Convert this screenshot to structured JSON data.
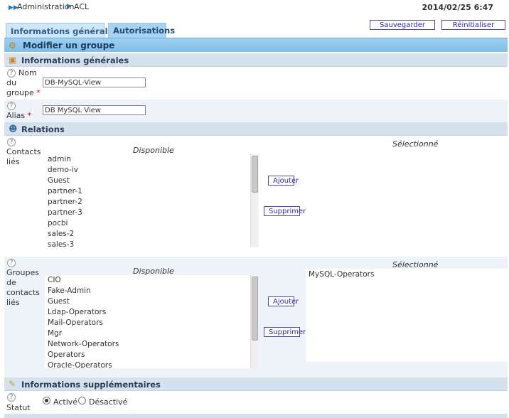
{
  "breadcrumb": {
    "root": "Administration",
    "current": "ACL"
  },
  "datetime": "2014/02/25 6:47",
  "tabs": {
    "general": "Informations générales",
    "auth": "Autorisations"
  },
  "toolbar": {
    "save_label": "Sauvegarder",
    "reset_label": "Réinitialiser"
  },
  "main": {
    "title": "Modifier un groupe"
  },
  "sections": {
    "general": "Informations générales",
    "relations": "Relations",
    "additional": "Informations supplémentaires"
  },
  "help_glyph": "?",
  "required_mark": "*",
  "fields": {
    "name": {
      "label_lines": [
        "Nom",
        "du",
        "groupe"
      ],
      "value": "DB-MySQL-View"
    },
    "alias": {
      "label": "Alias",
      "value": "DB MySQL View"
    }
  },
  "contacts": {
    "label_lines": [
      "Contacts",
      "liés"
    ],
    "available_header": "Disponible",
    "selected_header": "Sélectionné",
    "available": [
      "admin",
      "demo-iv",
      "Guest",
      "partner-1",
      "partner-2",
      "partner-3",
      "pocbi",
      "sales-2",
      "sales-3"
    ],
    "selected": [],
    "add_label": "Ajouter",
    "remove_label": "Supprimer"
  },
  "contact_groups": {
    "label_lines": [
      "Groupes",
      "de",
      "contacts",
      "liés"
    ],
    "available_header": "Disponible",
    "selected_header": "Sélectionné",
    "available": [
      "CIO",
      "Fake-Admin",
      "Guest",
      "Ldap-Operators",
      "Mail-Operators",
      "Mgr",
      "Network-Operators",
      "Operators",
      "Oracle-Operators"
    ],
    "selected": [
      "MySQL-Operators"
    ],
    "add_label": "Ajouter",
    "remove_label": "Supprimer"
  },
  "status": {
    "label": "Statut",
    "options": [
      "Activé",
      "Désactivé"
    ],
    "selected": "Activé"
  }
}
